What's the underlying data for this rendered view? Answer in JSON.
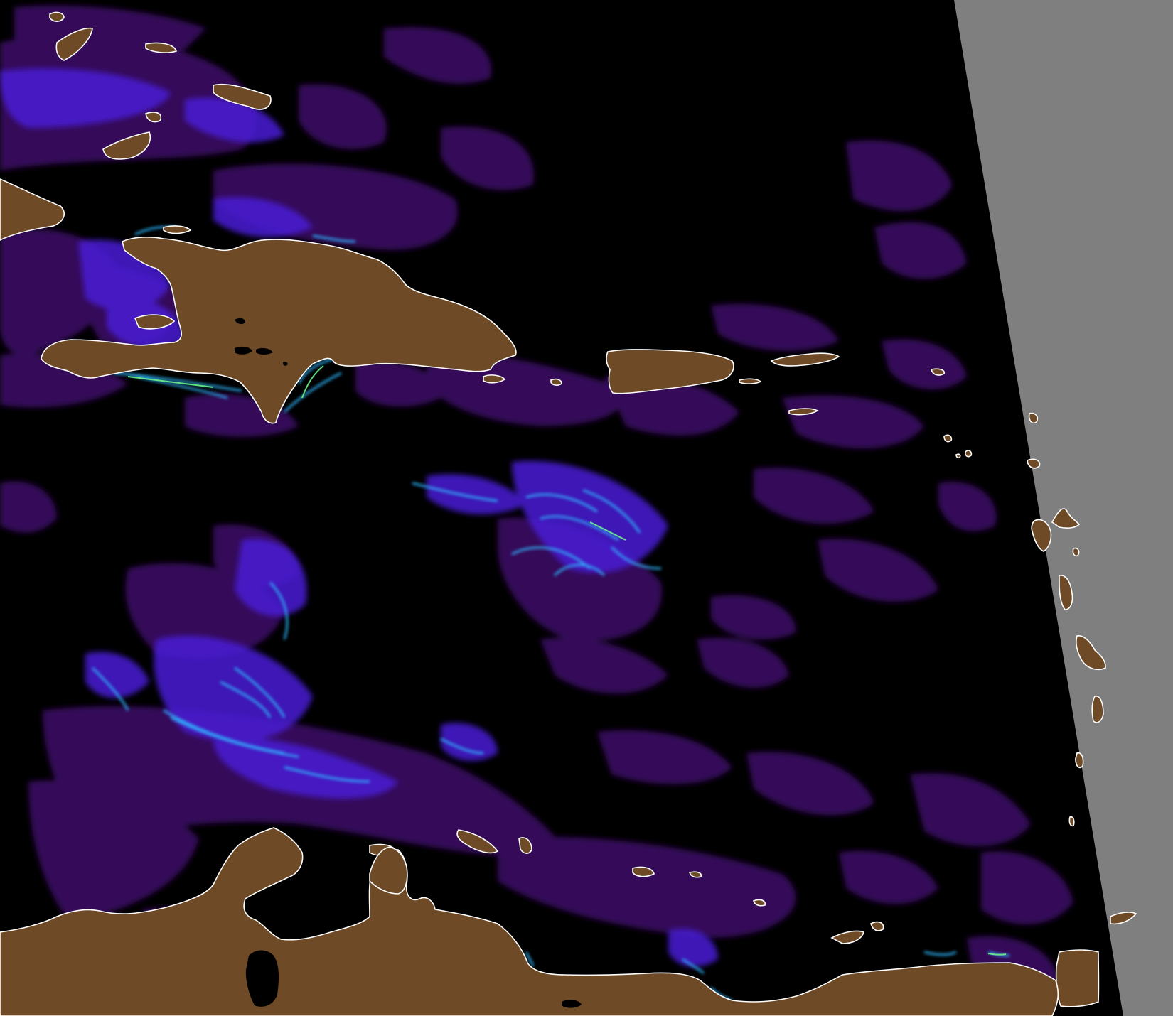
{
  "map": {
    "colors": {
      "background": "#000000",
      "no_data": "#7f7f7f",
      "land": "#6e4a26",
      "coastline": "#ffffff",
      "low_concentration": "#3b0a63",
      "medium_concentration": "#4a1fd6",
      "high_concentration": "#2fb8ff",
      "very_high_concentration": "#6cf28a"
    },
    "legend": [],
    "labels": []
  }
}
